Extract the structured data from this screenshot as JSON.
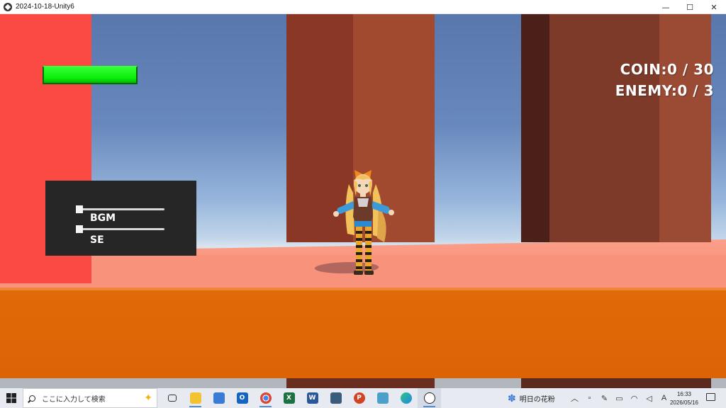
{
  "window": {
    "title": "2024-10-18-Unity6",
    "minimize": "—",
    "maximize": "☐",
    "close": "✕"
  },
  "hud": {
    "health_fraction": 1.0,
    "health_color": "#10ee10",
    "coin_text": "COIN:0 / 30",
    "enemy_text": "ENEMY:0 / 3"
  },
  "settings": {
    "bgm_label": "BGM",
    "se_label": "SE",
    "bgm_value": 0.0,
    "se_value": 0.0
  },
  "taskbar": {
    "search_placeholder": "ここに入力して検索",
    "weather_text": "明日の花粉",
    "time": "16:33",
    "date": "2026/05/16",
    "ime": "A",
    "apps": [
      "task-view",
      "file-explorer",
      "store",
      "outlook",
      "chrome",
      "excel",
      "word",
      "calculator",
      "powerpoint",
      "notepad",
      "edge",
      "unity"
    ]
  }
}
